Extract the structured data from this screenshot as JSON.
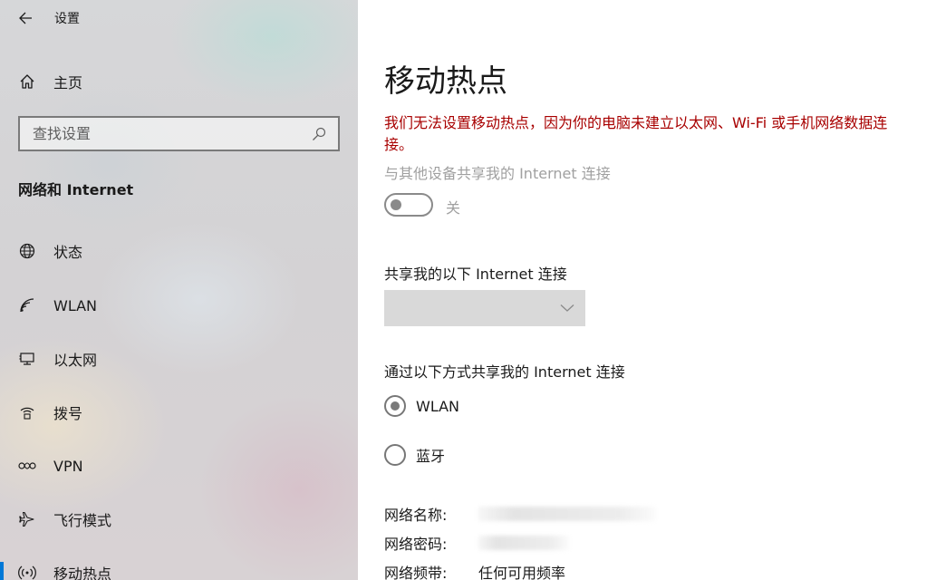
{
  "window": {
    "title": "设置",
    "back_icon": "back-arrow-icon"
  },
  "sidebar": {
    "home_label": "主页",
    "search": {
      "placeholder": "查找设置",
      "value": ""
    },
    "section_title": "网络和 Internet",
    "items": [
      {
        "label": "状态",
        "icon": "globe-icon",
        "active": false
      },
      {
        "label": "WLAN",
        "icon": "wifi-icon",
        "active": false
      },
      {
        "label": "以太网",
        "icon": "ethernet-icon",
        "active": false
      },
      {
        "label": "拨号",
        "icon": "dialup-icon",
        "active": false
      },
      {
        "label": "VPN",
        "icon": "vpn-icon",
        "active": false
      },
      {
        "label": "飞行模式",
        "icon": "airplane-icon",
        "active": false
      },
      {
        "label": "移动热点",
        "icon": "hotspot-icon",
        "active": true
      }
    ]
  },
  "main": {
    "title": "移动热点",
    "error_message": "我们无法设置移动热点，因为你的电脑未建立以太网、Wi-Fi 或手机网络数据连接。",
    "share_label": "与其他设备共享我的 Internet 连接",
    "toggle_state": "关",
    "toggle_on": false,
    "connection_label": "共享我的以下 Internet 连接",
    "connection_selected": "",
    "method_label": "通过以下方式共享我的 Internet 连接",
    "methods": [
      {
        "label": "WLAN",
        "checked": true
      },
      {
        "label": "蓝牙",
        "checked": false
      }
    ],
    "properties": [
      {
        "key": "网络名称:",
        "value": ""
      },
      {
        "key": "网络密码:",
        "value": ""
      },
      {
        "key": "网络频带:",
        "value": "任何可用频率"
      }
    ]
  },
  "colors": {
    "error": "#a80000",
    "accent": "#0078d7",
    "disabled_text": "#a0a0a0"
  }
}
